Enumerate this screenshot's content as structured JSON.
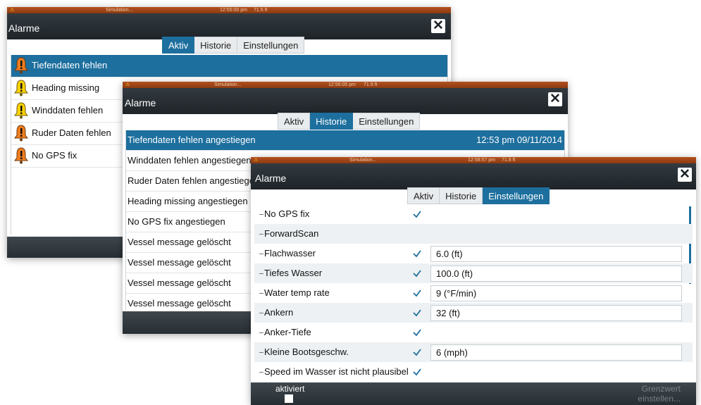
{
  "window1": {
    "status_sim": "Simulation...",
    "status_time": "12:55:00 pm",
    "status_temp": "71.5 ft",
    "title": "Alarme",
    "tabs": [
      {
        "label": "Aktiv",
        "active": true
      },
      {
        "label": "Historie",
        "active": false
      },
      {
        "label": "Einstellungen",
        "active": false
      }
    ],
    "alarms": [
      {
        "label": "Tiefendaten fehlen",
        "color": "#f07d1e",
        "selected": true
      },
      {
        "label": "Heading missing",
        "color": "#ffd200",
        "selected": false
      },
      {
        "label": "Winddaten fehlen",
        "color": "#ffd200",
        "selected": false
      },
      {
        "label": "Ruder Daten fehlen",
        "color": "#f07d1e",
        "selected": false
      },
      {
        "label": "No GPS fix",
        "color": "#f07d1e",
        "selected": false
      }
    ]
  },
  "window2": {
    "status_sim": "Simulation...",
    "status_time": "12:56:05 pm",
    "status_temp": "71.9 ft",
    "title": "Alarme",
    "tabs": [
      {
        "label": "Aktiv",
        "active": false
      },
      {
        "label": "Historie",
        "active": true
      },
      {
        "label": "Einstellungen",
        "active": false
      }
    ],
    "history": [
      {
        "label": "Tiefendaten fehlen angestiegen",
        "time": "12:53 pm 09/11/2014",
        "selected": true
      },
      {
        "label": "Winddaten fehlen angestiegen",
        "time": "",
        "selected": false
      },
      {
        "label": "Ruder Daten fehlen angestiegen",
        "time": "",
        "selected": false
      },
      {
        "label": "Heading missing angestiegen",
        "time": "",
        "selected": false
      },
      {
        "label": "No GPS fix angestiegen",
        "time": "",
        "selected": false
      },
      {
        "label": "Vessel message gelöscht",
        "time": "",
        "selected": false
      },
      {
        "label": "Vessel message gelöscht",
        "time": "",
        "selected": false
      },
      {
        "label": "Vessel message gelöscht",
        "time": "",
        "selected": false
      },
      {
        "label": "Vessel message gelöscht",
        "time": "",
        "selected": false
      }
    ]
  },
  "window3": {
    "status_sim": "Simulation...",
    "status_time": "12:58:57 pm",
    "status_temp": "71.8 ft",
    "title": "Alarme",
    "tabs": [
      {
        "label": "Aktiv",
        "active": false
      },
      {
        "label": "Historie",
        "active": false
      },
      {
        "label": "Einstellungen",
        "active": true
      }
    ],
    "settings": [
      {
        "label": "No GPS fix",
        "checked": true,
        "value": ""
      },
      {
        "label": "ForwardScan",
        "checked": false,
        "value": ""
      },
      {
        "label": "Flachwasser",
        "checked": true,
        "value": "6.0 (ft)"
      },
      {
        "label": "Tiefes Wasser",
        "checked": true,
        "value": "100.0 (ft)"
      },
      {
        "label": "Water temp rate",
        "checked": true,
        "value": "9 (°F/min)"
      },
      {
        "label": "Ankern",
        "checked": true,
        "value": "32 (ft)"
      },
      {
        "label": "Anker-Tiefe",
        "checked": true,
        "value": ""
      },
      {
        "label": "Kleine Bootsgeschw.",
        "checked": true,
        "value": "6 (mph)"
      },
      {
        "label": "Speed im Wasser ist nicht plausibel",
        "checked": true,
        "value": ""
      }
    ],
    "bottom_left": "aktiviert",
    "bottom_right_1": "Grenzwert",
    "bottom_right_2": "einstellen..."
  },
  "colors": {
    "accent": "#1d6f9e",
    "titlebar": "#2a3136",
    "statusbar": "#a0461a"
  }
}
